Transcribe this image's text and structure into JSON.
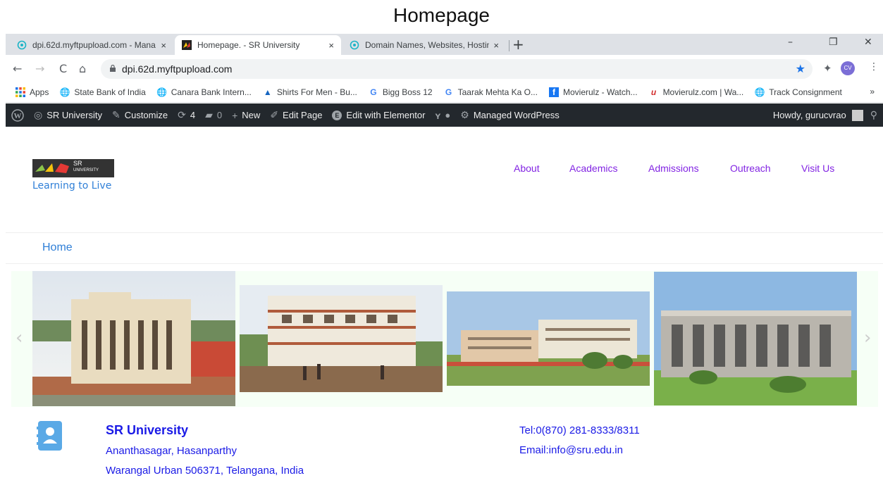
{
  "caption": "Homepage",
  "browser": {
    "tabs": [
      {
        "title": "dpi.62d.myftpupload.com - Mana",
        "close": "×"
      },
      {
        "title": "Homepage. - SR University",
        "close": "×"
      },
      {
        "title": "Domain Names, Websites, Hostin",
        "close": "×"
      }
    ],
    "new_tab": "+",
    "window_controls": {
      "minimize": "–",
      "restore": "❐",
      "close": "✕"
    },
    "nav": {
      "back": "←",
      "forward": "→",
      "reload": "C",
      "home": "⌂"
    },
    "url": "dpi.62d.myftpupload.com",
    "profile_initials": "CV",
    "bookmarks": [
      {
        "label": "Apps",
        "icon": "apps-grid-icon"
      },
      {
        "label": "State Bank of India",
        "icon": "globe-icon"
      },
      {
        "label": "Canara Bank Intern...",
        "icon": "globe-icon"
      },
      {
        "label": "Shirts For Men - Bu...",
        "icon": "triangle-icon"
      },
      {
        "label": "Bigg Boss 12",
        "icon": "google-icon"
      },
      {
        "label": "Taarak Mehta Ka O...",
        "icon": "google-icon"
      },
      {
        "label": "Movierulz - Watch...",
        "icon": "facebook-icon"
      },
      {
        "label": "Movierulz.com | Wa...",
        "icon": "movierulz-icon"
      },
      {
        "label": "Track Consignment",
        "icon": "globe-icon"
      }
    ],
    "bookmarks_more": "»"
  },
  "adminbar": {
    "site": "SR University",
    "customize": "Customize",
    "updates": "4",
    "comments": "0",
    "new": "New",
    "edit_page": "Edit Page",
    "edit_elementor": "Edit with Elementor",
    "managed": "Managed WordPress",
    "howdy": "Howdy, gurucvrao"
  },
  "site": {
    "logo_text_1": "SR",
    "logo_text_2": "UNIVERSITY",
    "tagline": "Learning to Live",
    "nav": [
      "About",
      "Academics",
      "Admissions",
      "Outreach",
      "Visit Us"
    ],
    "breadcrumb": "Home"
  },
  "carousel": {
    "prev": "‹",
    "next": "›"
  },
  "contact": {
    "name": "SR University",
    "address1": "Ananthasagar, Hasanparthy",
    "address2": "Warangal Urban 506371, Telangana, India",
    "tel": "Tel:0(870) 281-8333/8311",
    "email": "Email:info@sru.edu.in"
  },
  "colors": {
    "link_purple": "#8224e3",
    "link_blue": "#2f7fd7",
    "contact_blue": "#1a1ae6",
    "adminbar": "#23282d"
  }
}
